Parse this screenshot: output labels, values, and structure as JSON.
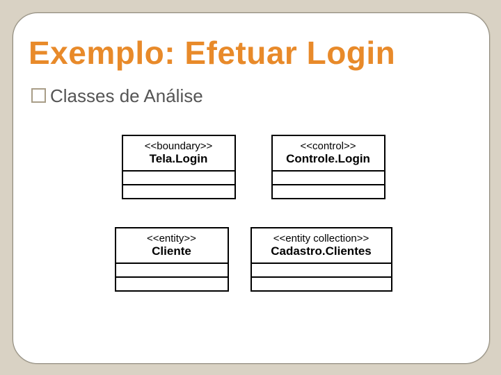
{
  "slide": {
    "title": "Exemplo: Efetuar Login",
    "subtitle": "Classes de Análise"
  },
  "uml": {
    "classes": [
      {
        "stereotype": "<<boundary>>",
        "name": "Tela.Login"
      },
      {
        "stereotype": "<<control>>",
        "name": "Controle.Login"
      },
      {
        "stereotype": "<<entity>>",
        "name": "Cliente"
      },
      {
        "stereotype": "<<entity collection>>",
        "name": "Cadastro.Clientes"
      }
    ]
  }
}
